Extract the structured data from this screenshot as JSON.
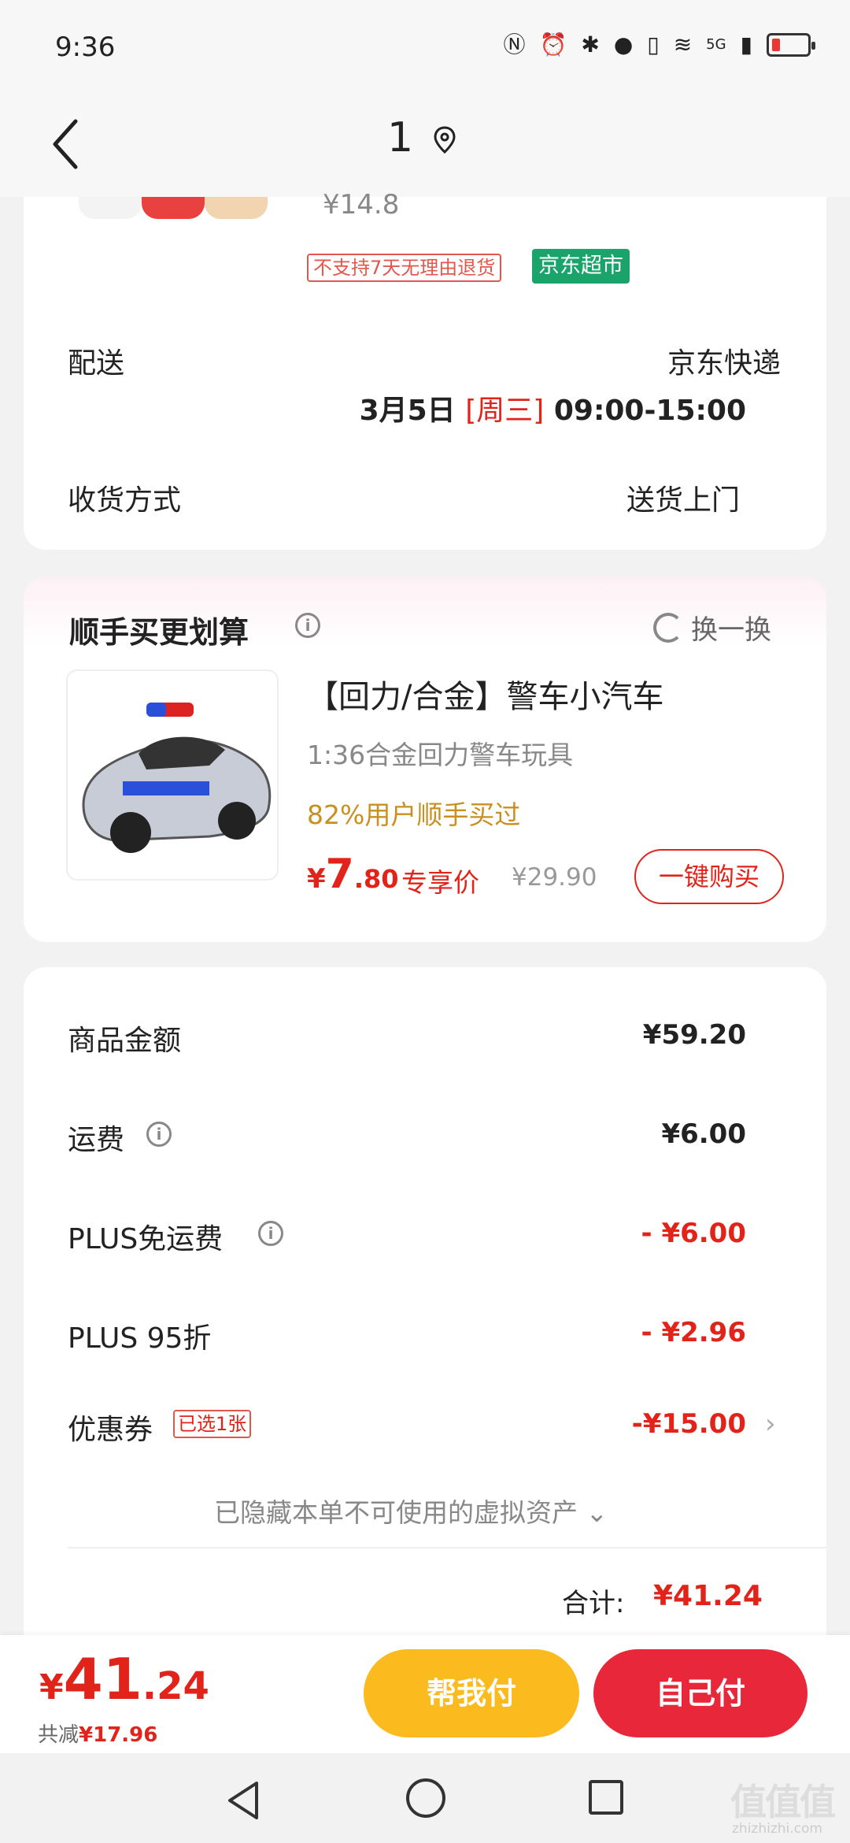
{
  "status_bar": {
    "time": "9:36",
    "network": "5G"
  },
  "header": {
    "title": "1"
  },
  "order_item": {
    "price": "¥14.8",
    "tag_no_return": "不支持7天无理由退货",
    "tag_store": "京东超市"
  },
  "delivery": {
    "label": "配送",
    "carrier": "京东快递",
    "date": "3月5日",
    "weekday": "[周三]",
    "window": "09:00-15:00"
  },
  "receive": {
    "label": "收货方式",
    "value": "送货上门"
  },
  "recommend": {
    "title": "顺手买更划算",
    "swap_label": "换一换",
    "product": {
      "name": "【回力/合金】警车小汽车",
      "desc": "1:36合金回力警车玩具",
      "social": "82%用户顺手买过",
      "price_symbol": "¥",
      "price_int": "7",
      "price_dec": ".80",
      "price_tag": "专享价",
      "original_price": "¥29.90",
      "buy_label": "一键购买"
    }
  },
  "summary": {
    "goods_label": "商品金额",
    "goods_value": "¥59.20",
    "shipping_label": "运费",
    "shipping_value": "¥6.00",
    "plus_free_label": "PLUS免运费",
    "plus_free_value": "- ¥6.00",
    "plus_discount_label": "PLUS 95折",
    "plus_discount_value": "- ¥2.96",
    "coupon_label": "优惠券",
    "coupon_tag": "已选1张",
    "coupon_value": "-¥15.00",
    "hidden_assets": "已隐藏本单不可使用的虚拟资产",
    "total_label": "合计:",
    "total_value": "¥41.24"
  },
  "bottom": {
    "price_symbol": "¥",
    "price_int": "41",
    "price_dec": ".24",
    "saved_prefix": "共减",
    "saved_amount": "¥17.96",
    "help_pay": "帮我付",
    "self_pay": "自己付"
  },
  "watermark": {
    "main": "值值值",
    "sub": "zhizhizhi.com"
  },
  "colors": {
    "accent_red": "#e2231a",
    "jd_green": "#1aa36b",
    "help_yellow": "#fbbb1e",
    "pay_red": "#e8283a"
  }
}
